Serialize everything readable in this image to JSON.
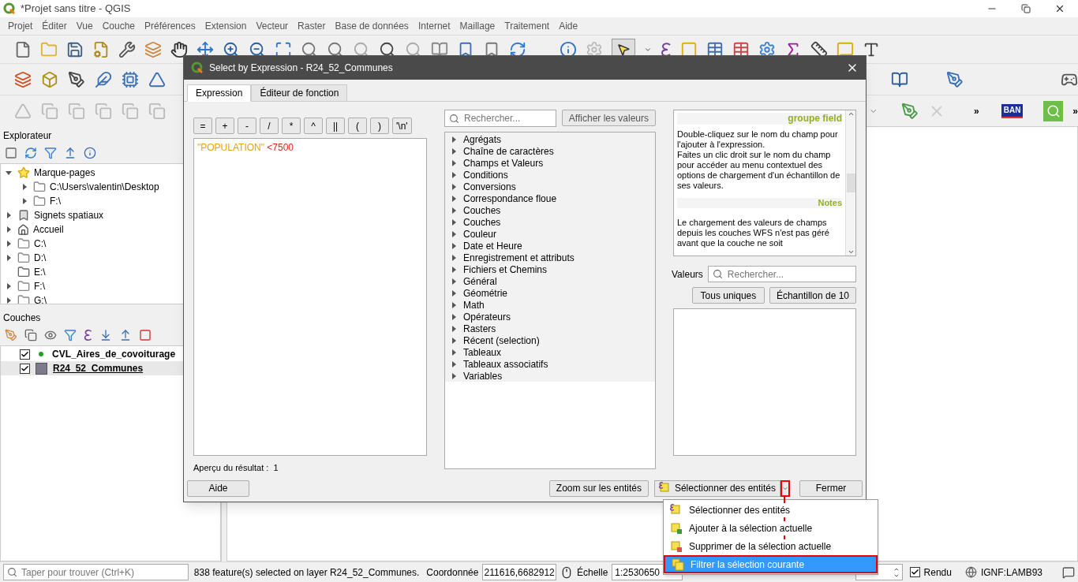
{
  "window": {
    "title": "*Projet sans titre - QGIS"
  },
  "menu": [
    "Projet",
    "Éditer",
    "Vue",
    "Couche",
    "Préférences",
    "Extension",
    "Vecteur",
    "Raster",
    "Base de données",
    "Internet",
    "Maillage",
    "Traitement",
    "Aide"
  ],
  "toolbar": {
    "overflow": [
      "»",
      "»"
    ],
    "logo_text": "BAN"
  },
  "explorer": {
    "title": "Explorateur",
    "items": [
      {
        "label": "Marque-pages",
        "kind": "bookmarks",
        "expandable": true,
        "expanded": true,
        "children": [
          {
            "label": "C:\\Users\\valentin\\Desktop",
            "kind": "folder",
            "expandable": true,
            "expanded": false
          },
          {
            "label": "F:\\",
            "kind": "folder",
            "expandable": true,
            "expanded": false
          }
        ]
      },
      {
        "label": "Signets spatiaux",
        "kind": "spatial",
        "expandable": true,
        "expanded": false
      },
      {
        "label": "Accueil",
        "kind": "home",
        "expandable": true,
        "expanded": false
      },
      {
        "label": "C:\\",
        "kind": "folder",
        "expandable": true,
        "expanded": false
      },
      {
        "label": "D:\\",
        "kind": "folder",
        "expandable": true,
        "expanded": false
      },
      {
        "label": "E:\\",
        "kind": "drive",
        "expandable": false,
        "expanded": false
      },
      {
        "label": "F:\\",
        "kind": "folder",
        "expandable": true,
        "expanded": false
      },
      {
        "label": "G:\\",
        "kind": "folder",
        "expandable": true,
        "expanded": false
      }
    ]
  },
  "layers": {
    "title": "Couches",
    "items": [
      {
        "name": "CVL_Aires_de_covoiturage",
        "kind": "point",
        "color": "#1fa31f",
        "checked": true,
        "selected": false
      },
      {
        "name": "R24_52_Communes",
        "kind": "polygon",
        "color": "#7e7a8a",
        "checked": true,
        "selected": true
      }
    ]
  },
  "dialog": {
    "title": "Select by Expression - R24_52_Communes",
    "tabs": [
      {
        "label": "Expression",
        "selected": true
      },
      {
        "label": "Éditeur de fonction",
        "selected": false
      }
    ],
    "operators": [
      "=",
      "+",
      "-",
      "/",
      "*",
      "^",
      "||",
      "(",
      ")",
      "'\\n'"
    ],
    "expression": [
      {
        "text": "\"POPULATION\"",
        "kind": "field"
      },
      {
        "text": " <7500",
        "kind": "value"
      }
    ],
    "preview": {
      "label": "Aperçu du résultat :",
      "value": "1"
    },
    "function_search": {
      "placeholder": "Rechercher..."
    },
    "show_values_button": "Afficher les valeurs",
    "function_groups": [
      "Agrégats",
      "Chaîne de caractères",
      "Champs et Valeurs",
      "Conditions",
      "Conversions",
      "Correspondance floue",
      "Couches",
      "Couches",
      "Couleur",
      "Date et Heure",
      "Enregistrement et attributs",
      "Fichiers et Chemins",
      "Général",
      "Géométrie",
      "Math",
      "Opérateurs",
      "Rasters",
      "Récent (selection)",
      "Tableaux",
      "Tableaux associatifs",
      "Variables"
    ],
    "help": {
      "title": "groupe field",
      "paragraphs": [
        "Double-cliquez sur le nom du champ pour l'ajouter à l'expression.",
        "Faites un clic droit sur le nom du champ pour accéder au menu contextuel des options de chargement d'un échantillon de ses valeurs."
      ],
      "notes_title": "Notes",
      "notes_text": "Le chargement des valeurs de champs depuis les couches WFS n'est pas géré avant que la couche ne soit"
    },
    "values": {
      "label": "Valeurs",
      "placeholder": "Rechercher...",
      "buttons": [
        "Tous uniques",
        "Échantillon de 10"
      ]
    },
    "buttons": {
      "help": "Aide",
      "zoom": "Zoom sur les entités",
      "select": "Sélectionner des entités",
      "close": "Fermer"
    }
  },
  "select_menu": {
    "items": [
      {
        "label": "Sélectionner des entités",
        "kind": "select",
        "selected": false
      },
      {
        "label": "Ajouter à la sélection actuelle",
        "kind": "add",
        "selected": false
      },
      {
        "label": "Supprimer de la sélection actuelle",
        "kind": "remove",
        "selected": false
      },
      {
        "label": "Filtrer la sélection courante",
        "kind": "filter",
        "selected": true
      }
    ]
  },
  "status_bar": {
    "search_placeholder": "Taper pour trouver (Ctrl+K)",
    "message": "838 feature(s) selected on layer R24_52_Communes.",
    "coordinate_label": "Coordonnée",
    "coordinate": "211616,6682912",
    "scale_label": "Échelle",
    "scale": "1:2530650",
    "render": {
      "label": "Rendu",
      "checked": true
    },
    "crs": "IGNF:LAMB93"
  }
}
